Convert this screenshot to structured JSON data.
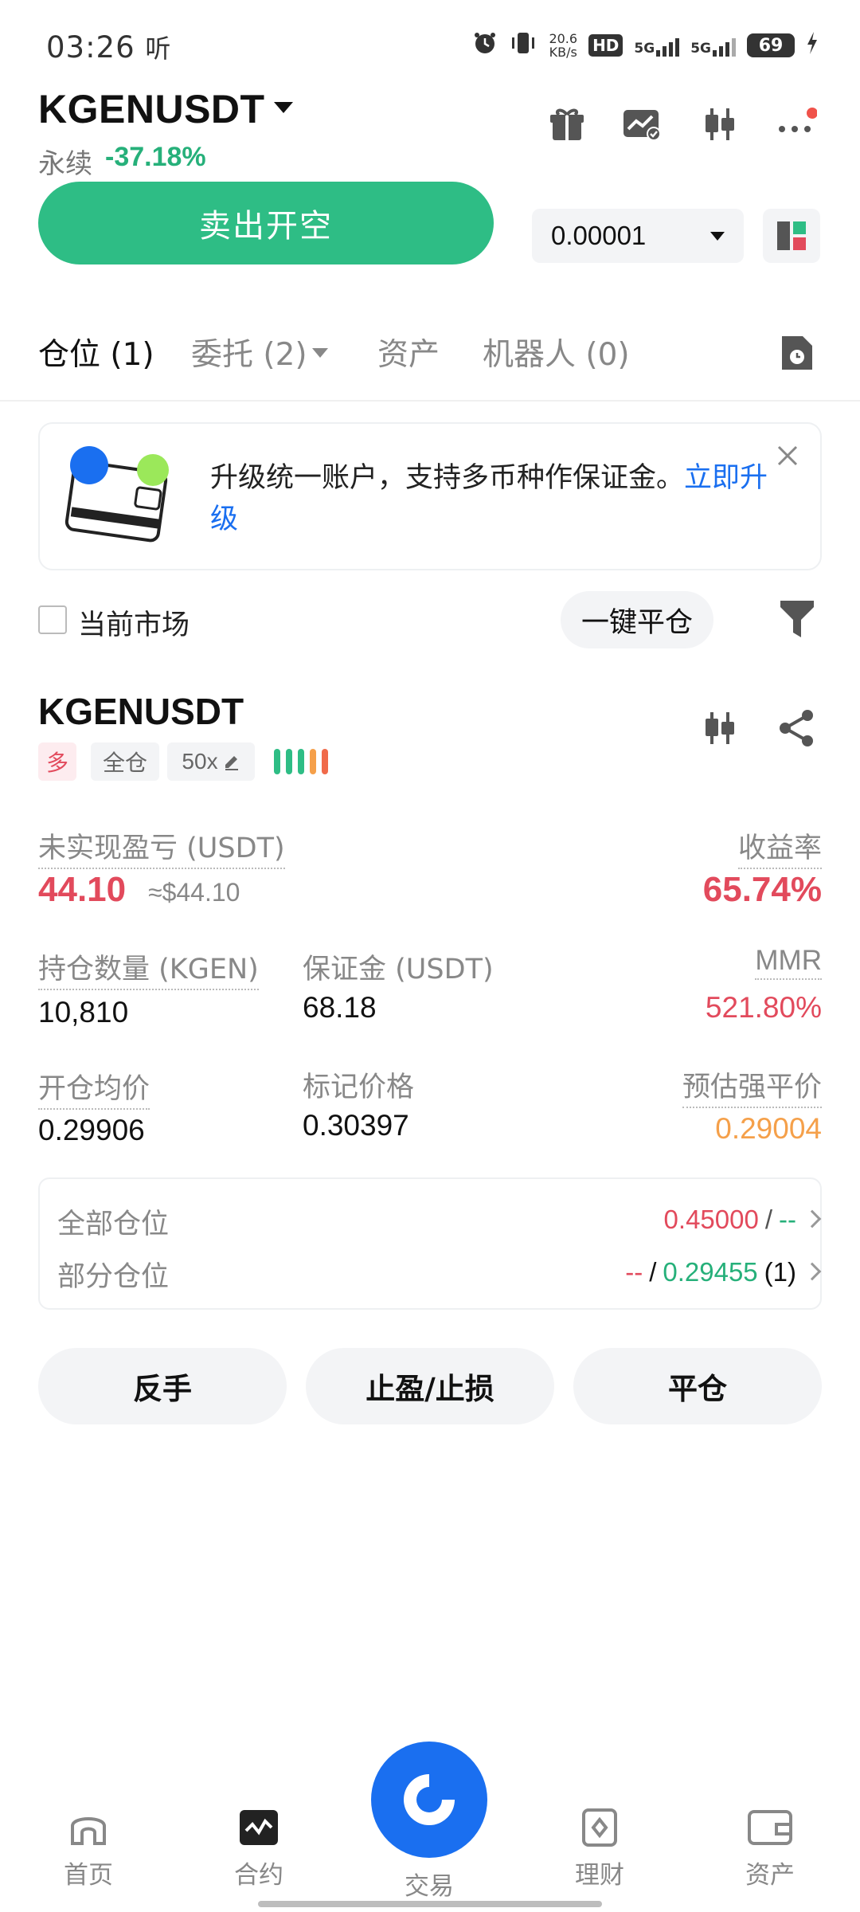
{
  "status_bar": {
    "time": "03:26",
    "carrier_glyph": "听",
    "net_speed_value": "20.6",
    "net_speed_unit": "KB/s",
    "hd_label": "HD",
    "net1": "5G",
    "net2": "5G",
    "battery": "69"
  },
  "header": {
    "symbol": "KGENUSDT",
    "contract_type": "永续",
    "change_pct": "-37.18%"
  },
  "trade": {
    "sell_label": "卖出开空",
    "price_step": "0.00001"
  },
  "tabs": [
    {
      "label": "仓位 (1)"
    },
    {
      "label": "委托 (2)"
    },
    {
      "label": "资产"
    },
    {
      "label": "机器人 (0)"
    }
  ],
  "banner": {
    "text": "升级统一账户，支持多币种作保证金。",
    "link": "立即升级"
  },
  "filter": {
    "current_market_label": "当前市场",
    "close_all_label": "一键平仓"
  },
  "position": {
    "symbol": "KGENUSDT",
    "side_tag": "多",
    "margin_mode_tag": "全仓",
    "leverage_tag": "50x",
    "unrealized_pnl_label": "未实现盈亏 (USDT)",
    "unrealized_pnl_value": "44.10",
    "unrealized_pnl_usd": "≈$44.10",
    "roe_label": "收益率",
    "roe_value": "65.74%",
    "size_label": "持仓数量 (KGEN)",
    "size_value": "10,810",
    "margin_label": "保证金 (USDT)",
    "margin_value": "68.18",
    "mmr_label": "MMR",
    "mmr_value": "521.80%",
    "entry_label": "开仓均价",
    "entry_value": "0.29906",
    "mark_label": "标记价格",
    "mark_value": "0.30397",
    "liq_label": "预估强平价",
    "liq_value": "0.29004"
  },
  "tpsl": {
    "full_label": "全部仓位",
    "full_tp": "0.45000",
    "full_sep": "/",
    "full_sl": "--",
    "partial_label": "部分仓位",
    "partial_tp": "--",
    "partial_sep": "/",
    "partial_sl": "0.29455",
    "partial_count": "(1)"
  },
  "actions": {
    "reverse": "反手",
    "tpsl": "止盈/止损",
    "close": "平仓"
  },
  "bottom_nav": {
    "home": "首页",
    "futures": "合约",
    "trade": "交易",
    "earn": "理财",
    "assets": "资产"
  },
  "colors": {
    "green": "#2ebd85",
    "red": "#e24a5c",
    "orange": "#f5a04a",
    "blue": "#1a6ff0"
  }
}
